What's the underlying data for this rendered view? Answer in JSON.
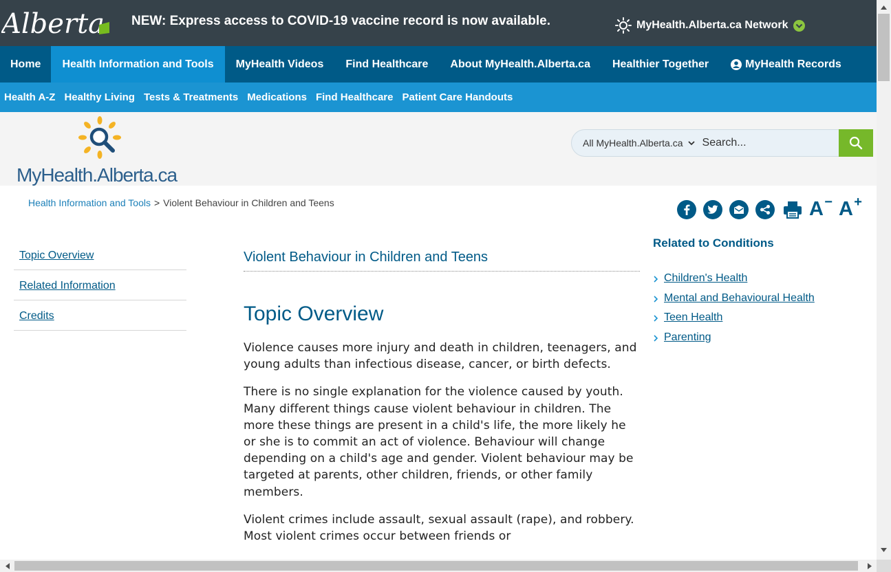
{
  "topbar": {
    "logo_text": "Alberta",
    "announcement": "NEW: Express access to COVID-19 vaccine record is now available.",
    "network_label": "MyHealth.Alberta.ca Network"
  },
  "main_nav": [
    {
      "label": "Home"
    },
    {
      "label": "Health Information and Tools"
    },
    {
      "label": "MyHealth Videos"
    },
    {
      "label": "Find Healthcare"
    },
    {
      "label": "About MyHealth.Alberta.ca"
    },
    {
      "label": "Healthier Together"
    },
    {
      "label": "MyHealth Records"
    }
  ],
  "sub_nav": [
    {
      "label": "Health A-Z"
    },
    {
      "label": "Healthy Living"
    },
    {
      "label": "Tests & Treatments"
    },
    {
      "label": "Medications"
    },
    {
      "label": "Find Healthcare"
    },
    {
      "label": "Patient Care Handouts"
    }
  ],
  "header": {
    "logo_text": "MyHealth.Alberta.ca",
    "search_scope": "All MyHealth.Alberta.ca",
    "search_placeholder": "Search..."
  },
  "breadcrumb": {
    "parent": "Health Information and Tools",
    "separator": ">",
    "current": "Violent Behaviour in Children and Teens"
  },
  "tools": {
    "decrease_text": "A",
    "decrease_sup": "−",
    "increase_text": "A",
    "increase_sup": "+"
  },
  "side_nav": [
    {
      "label": "Topic Overview"
    },
    {
      "label": "Related Information"
    },
    {
      "label": "Credits"
    }
  ],
  "article": {
    "page_title": "Violent Behaviour in Children and Teens",
    "section_heading": "Topic Overview",
    "paragraphs": [
      "Violence causes more injury and death in children, teenagers, and young adults than infectious disease, cancer, or birth defects.",
      "There is no single explanation for the violence caused by youth. Many different things cause violent behaviour in children. The more these things are present in a child's life, the more likely he or she is to commit an act of violence. Behaviour will change depending on a child's age and gender. Violent behaviour may be targeted at parents, other children, friends, or other family members.",
      "Violent crimes include assault, sexual assault (rape), and robbery. Most violent crimes occur between friends or"
    ]
  },
  "related": {
    "heading": "Related to Conditions",
    "links": [
      {
        "label": "Children's Health"
      },
      {
        "label": "Mental and Behavioural Health"
      },
      {
        "label": "Teen Health"
      },
      {
        "label": "Parenting"
      }
    ]
  },
  "colors": {
    "topbar": "#36424a",
    "main_nav": "#005a87",
    "main_nav_active": "#0f8fd1",
    "sub_nav": "#1b94d2",
    "accent_green": "#76b82a"
  }
}
